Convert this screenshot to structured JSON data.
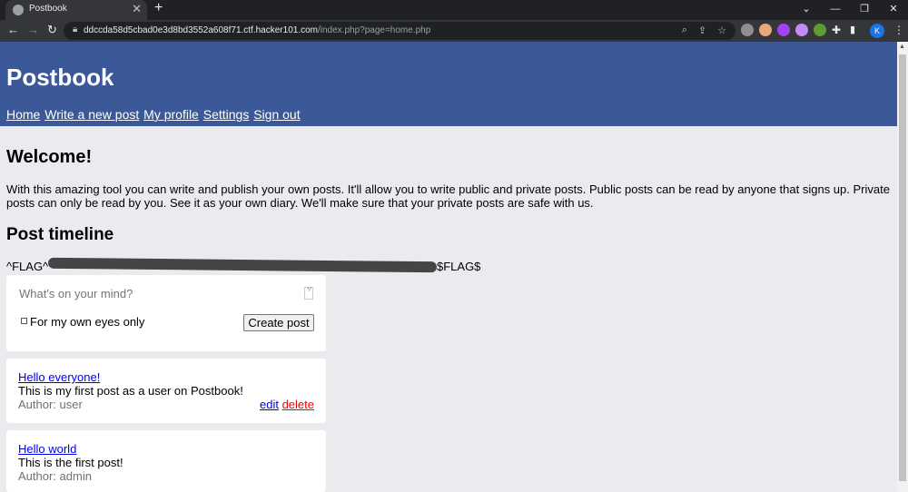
{
  "browser": {
    "tab_title": "Postbook",
    "tab_close": "✕",
    "new_tab": "+",
    "url_host": "ddccda58d5cbad0e3d8bd3552a608f71.ctf.hacker101.com",
    "url_path": "/index.php?page=home.php",
    "profile_initial": "K",
    "extension_colors": [
      "#8e8e8e",
      "#e8a87c",
      "#a142f4",
      "#c58af9",
      "#5e9b35"
    ]
  },
  "header": {
    "site_title": "Postbook",
    "nav": {
      "home": "Home",
      "write_post": "Write a new post",
      "profile": "My profile",
      "settings": "Settings",
      "sign_out": "Sign out"
    }
  },
  "main": {
    "welcome_heading": "Welcome!",
    "intro": "With this amazing tool you can write and publish your own posts. It'll allow you to write public and private posts. Public posts can be read by anyone that signs up. Private posts can only be read by you. See it as your own diary. We'll make sure that your private posts are safe with us.",
    "timeline_heading": "Post timeline",
    "flag_start": "^FLAG^",
    "flag_end": "$FLAG$"
  },
  "composer": {
    "placeholder": "What's on your mind?",
    "private_label": "For my own eyes only",
    "private_checked": false,
    "submit_label": "Create post"
  },
  "posts": [
    {
      "title": "Hello everyone!",
      "body": "This is my first post as a user on Postbook!",
      "author": "Author: user",
      "edit_label": "edit",
      "delete_label": "delete"
    },
    {
      "title": "Hello world",
      "body": "This is the first post!",
      "author": "Author: admin"
    }
  ],
  "colors": {
    "header_bg": "#3b5998",
    "page_bg": "#e9ebee",
    "link": "#0000ee",
    "delete": "#ff0000"
  }
}
